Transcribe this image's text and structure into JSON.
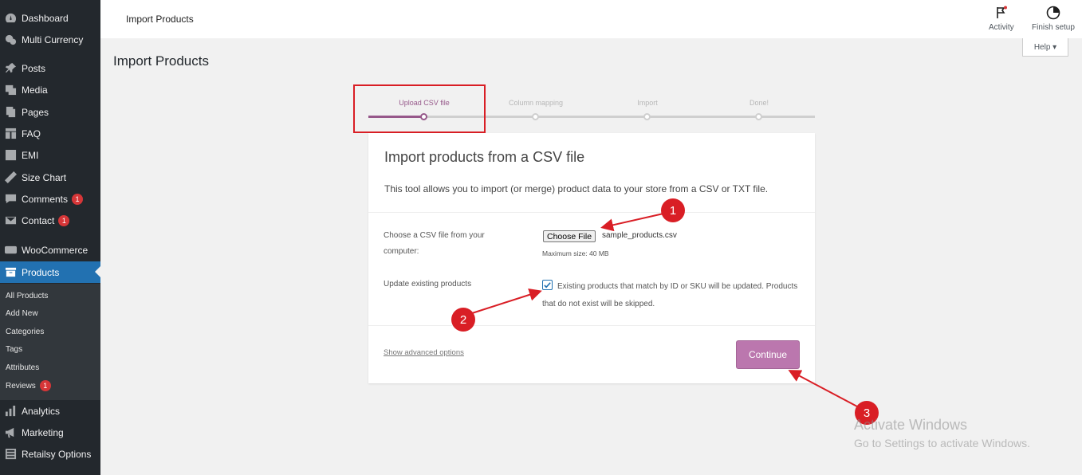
{
  "sidebar": {
    "items": [
      {
        "label": "Dashboard",
        "icon": "dashboard-icon",
        "badge": ""
      },
      {
        "label": "Multi Currency",
        "icon": "currency-icon",
        "badge": ""
      },
      {
        "label": "Posts",
        "icon": "pin-icon",
        "badge": ""
      },
      {
        "label": "Media",
        "icon": "media-icon",
        "badge": ""
      },
      {
        "label": "Pages",
        "icon": "pages-icon",
        "badge": ""
      },
      {
        "label": "FAQ",
        "icon": "faq-icon",
        "badge": ""
      },
      {
        "label": "EMI",
        "icon": "emi-icon",
        "badge": ""
      },
      {
        "label": "Size Chart",
        "icon": "ruler-icon",
        "badge": ""
      },
      {
        "label": "Comments",
        "icon": "comment-icon",
        "badge": "1"
      },
      {
        "label": "Contact",
        "icon": "mail-icon",
        "badge": "1"
      },
      {
        "label": "WooCommerce",
        "icon": "woo-icon",
        "badge": ""
      },
      {
        "label": "Products",
        "icon": "archive-icon",
        "badge": ""
      },
      {
        "label": "Analytics",
        "icon": "chart-bar-icon",
        "badge": ""
      },
      {
        "label": "Marketing",
        "icon": "megaphone-icon",
        "badge": ""
      },
      {
        "label": "Retailsy Options",
        "icon": "list-icon",
        "badge": ""
      }
    ],
    "submenu": [
      {
        "label": "All Products",
        "badge": ""
      },
      {
        "label": "Add New",
        "badge": ""
      },
      {
        "label": "Categories",
        "badge": ""
      },
      {
        "label": "Tags",
        "badge": ""
      },
      {
        "label": "Attributes",
        "badge": ""
      },
      {
        "label": "Reviews",
        "badge": "1"
      }
    ]
  },
  "topbar": {
    "title": "Import Products",
    "activity_label": "Activity",
    "finish_setup_label": "Finish setup",
    "help_label": "Help ▾"
  },
  "page": {
    "heading": "Import Products"
  },
  "stepper": {
    "steps": [
      "Upload CSV file",
      "Column mapping",
      "Import",
      "Done!"
    ],
    "active_index": 0
  },
  "card": {
    "title": "Import products from a CSV file",
    "description": "This tool allows you to import (or merge) product data to your store from a CSV or TXT file.",
    "file_label_line1": "Choose a CSV file from your",
    "file_label_line2": "computer:",
    "choose_file_label": "Choose File",
    "file_name": "sample_products.csv",
    "max_size": "Maximum size: 40 MB",
    "update_label": "Update existing products",
    "update_checked": true,
    "update_desc": "Existing products that match by ID or SKU will be updated. Products that do not exist will be skipped.",
    "advanced_link": "Show advanced options",
    "continue_label": "Continue"
  },
  "annotations": {
    "callouts": [
      "1",
      "2",
      "3"
    ],
    "color": "#d91e25"
  },
  "watermark": {
    "line1": "Activate Windows",
    "line2": "Go to Settings to activate Windows."
  },
  "colors": {
    "sidebar_bg": "#23282d",
    "active_menu": "#2271b1",
    "woo_purple": "#96588a",
    "continue_button": "#bb77ae",
    "badge": "#d63638"
  }
}
